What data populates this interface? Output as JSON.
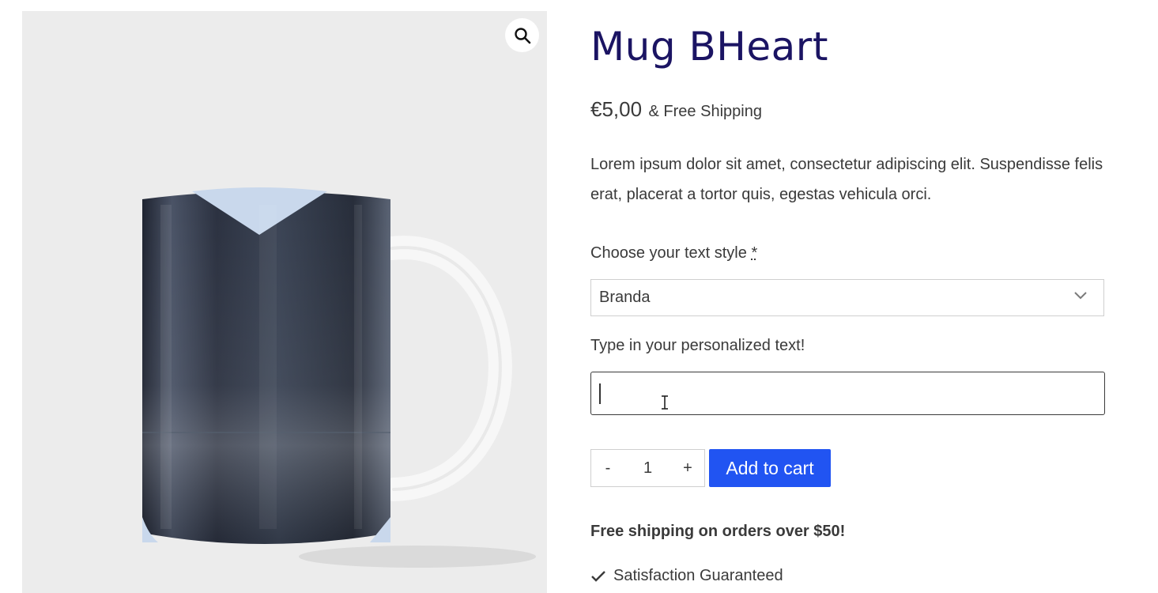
{
  "product": {
    "title": "Mug BHeart",
    "price": "€5,00",
    "shipping_suffix": "& Free Shipping",
    "description": "Lorem ipsum dolor sit amet, consectetur adipiscing elit. Suspendisse felis erat, placerat a tortor quis, egestas vehicula orci."
  },
  "gallery": {
    "zoom_icon": "magnifier-icon"
  },
  "options": {
    "style_label": "Choose your text style",
    "required_mark": "*",
    "style_selected": "Branda",
    "text_label": "Type in your personalized text!",
    "text_value": ""
  },
  "cart": {
    "minus_label": "-",
    "quantity": "1",
    "plus_label": "+",
    "add_label": "Add to cart",
    "button_color": "#2154f2"
  },
  "promo": {
    "shipping_note": "Free shipping on orders over $50!",
    "features": [
      {
        "icon": "checkmark-icon",
        "label": "Satisfaction Guaranteed"
      }
    ]
  },
  "colors": {
    "title": "#1b1463",
    "text": "#3a3a3a"
  }
}
